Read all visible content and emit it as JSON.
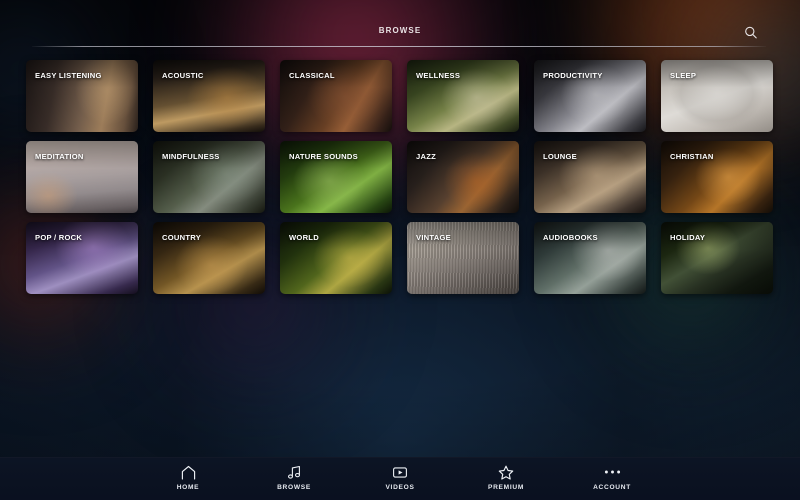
{
  "header": {
    "title": "BROWSE",
    "search_icon": "search-icon"
  },
  "grid": {
    "cards": [
      {
        "label": "EASY LISTENING",
        "art": "art-easy-listening",
        "name": "easy-listening"
      },
      {
        "label": "ACOUSTIC",
        "art": "art-acoustic",
        "name": "acoustic"
      },
      {
        "label": "CLASSICAL",
        "art": "art-classical",
        "name": "classical"
      },
      {
        "label": "WELLNESS",
        "art": "art-wellness",
        "name": "wellness"
      },
      {
        "label": "PRODUCTIVITY",
        "art": "art-productivity",
        "name": "productivity"
      },
      {
        "label": "SLEEP",
        "art": "art-sleep",
        "name": "sleep"
      },
      {
        "label": "MEDITATION",
        "art": "art-meditation",
        "name": "meditation"
      },
      {
        "label": "MINDFULNESS",
        "art": "art-mindfulness",
        "name": "mindfulness"
      },
      {
        "label": "NATURE SOUNDS",
        "art": "art-nature-sounds",
        "name": "nature-sounds"
      },
      {
        "label": "JAZZ",
        "art": "art-jazz",
        "name": "jazz"
      },
      {
        "label": "LOUNGE",
        "art": "art-lounge",
        "name": "lounge"
      },
      {
        "label": "CHRISTIAN",
        "art": "art-christian",
        "name": "christian"
      },
      {
        "label": "POP / ROCK",
        "art": "art-pop-rock",
        "name": "pop-rock"
      },
      {
        "label": "COUNTRY",
        "art": "art-country",
        "name": "country"
      },
      {
        "label": "WORLD",
        "art": "art-world",
        "name": "world"
      },
      {
        "label": "VINTAGE",
        "art": "art-vintage",
        "name": "vintage"
      },
      {
        "label": "AUDIOBOOKS",
        "art": "art-audiobooks",
        "name": "audiobooks"
      },
      {
        "label": "HOLIDAY",
        "art": "art-holiday",
        "name": "holiday"
      }
    ]
  },
  "nav": {
    "items": [
      {
        "label": "HOME",
        "icon": "home-icon",
        "name": "home"
      },
      {
        "label": "BROWSE",
        "icon": "music-note-icon",
        "name": "browse"
      },
      {
        "label": "VIDEOS",
        "icon": "video-play-icon",
        "name": "videos"
      },
      {
        "label": "PREMIUM",
        "icon": "star-icon",
        "name": "premium"
      },
      {
        "label": "ACCOUNT",
        "icon": "ellipsis-icon",
        "name": "account"
      }
    ]
  },
  "colors": {
    "background": "#05060a",
    "nav_background": "#0b1221",
    "text": "#ffffff",
    "divider": "#cdcdd7"
  }
}
